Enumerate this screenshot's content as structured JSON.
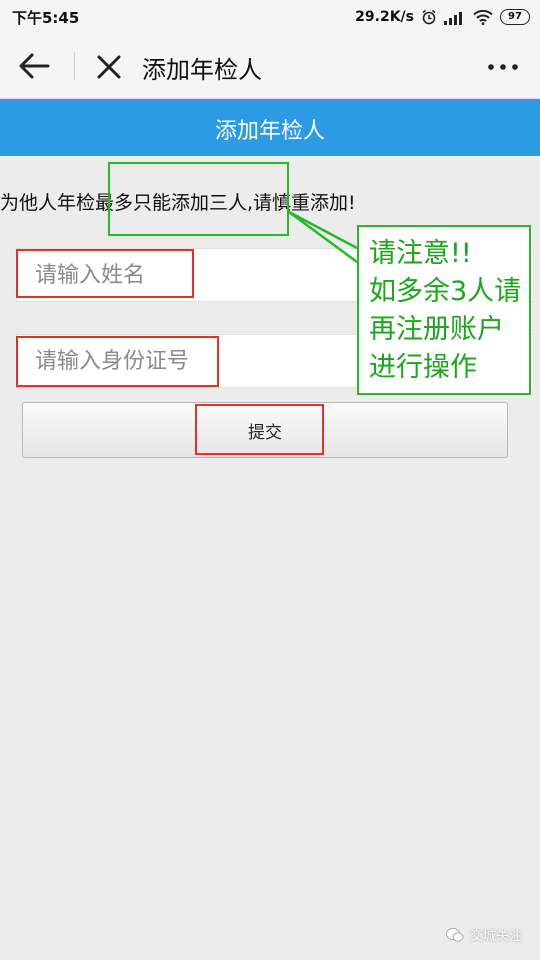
{
  "status_bar": {
    "time": "下午5:45",
    "net_speed": "29.2K/s",
    "battery": "97",
    "icons": [
      "alarm-icon",
      "signal-icon",
      "wifi-icon",
      "battery-icon"
    ]
  },
  "nav": {
    "title": "添加年检人",
    "icons": [
      "back-arrow-icon",
      "close-icon",
      "more-icon"
    ]
  },
  "header": {
    "title": "添加年检人",
    "color": "#2d9ae4"
  },
  "notice": {
    "text": "为他人年检最多只能添加三人,请慎重添加!"
  },
  "form": {
    "name_placeholder": "请输入姓名",
    "id_placeholder": "请输入身份证号",
    "submit_label": "提交"
  },
  "annotation": {
    "line1": "请注意!!",
    "line2": "如多余3人请",
    "line3": "再注册账户",
    "line4": "进行操作",
    "red": "#e8302a",
    "green": "#2ab72a"
  },
  "watermark": {
    "text": "交城关注"
  }
}
